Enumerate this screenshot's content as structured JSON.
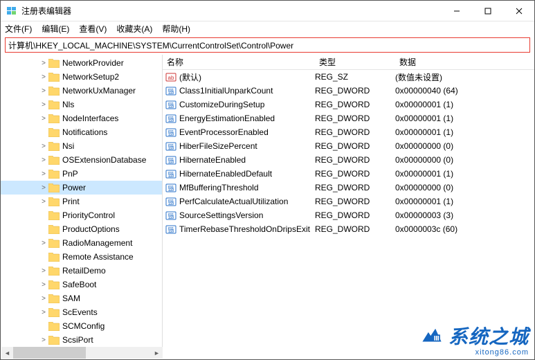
{
  "window": {
    "title": "注册表编辑器"
  },
  "menu": {
    "file": "文件(F)",
    "edit": "编辑(E)",
    "view": "查看(V)",
    "favorites": "收藏夹(A)",
    "help": "帮助(H)"
  },
  "address": "计算机\\HKEY_LOCAL_MACHINE\\SYSTEM\\CurrentControlSet\\Control\\Power",
  "tree": [
    {
      "label": "NetworkProvider",
      "depth": 3,
      "exp": ">"
    },
    {
      "label": "NetworkSetup2",
      "depth": 3,
      "exp": ">"
    },
    {
      "label": "NetworkUxManager",
      "depth": 3,
      "exp": ">"
    },
    {
      "label": "Nls",
      "depth": 3,
      "exp": ">"
    },
    {
      "label": "NodeInterfaces",
      "depth": 3,
      "exp": ">"
    },
    {
      "label": "Notifications",
      "depth": 3,
      "exp": ""
    },
    {
      "label": "Nsi",
      "depth": 3,
      "exp": ">"
    },
    {
      "label": "OSExtensionDatabase",
      "depth": 3,
      "exp": ">"
    },
    {
      "label": "PnP",
      "depth": 3,
      "exp": ">"
    },
    {
      "label": "Power",
      "depth": 3,
      "exp": ">",
      "selected": true
    },
    {
      "label": "Print",
      "depth": 3,
      "exp": ">"
    },
    {
      "label": "PriorityControl",
      "depth": 3,
      "exp": ""
    },
    {
      "label": "ProductOptions",
      "depth": 3,
      "exp": ""
    },
    {
      "label": "RadioManagement",
      "depth": 3,
      "exp": ">"
    },
    {
      "label": "Remote Assistance",
      "depth": 3,
      "exp": ""
    },
    {
      "label": "RetailDemo",
      "depth": 3,
      "exp": ">"
    },
    {
      "label": "SafeBoot",
      "depth": 3,
      "exp": ">"
    },
    {
      "label": "SAM",
      "depth": 3,
      "exp": ">"
    },
    {
      "label": "ScEvents",
      "depth": 3,
      "exp": ">"
    },
    {
      "label": "SCMConfig",
      "depth": 3,
      "exp": ""
    },
    {
      "label": "ScsiPort",
      "depth": 3,
      "exp": ">"
    }
  ],
  "columns": {
    "name": "名称",
    "type": "类型",
    "data": "数据"
  },
  "values": [
    {
      "icon": "sz",
      "name": "(默认)",
      "type": "REG_SZ",
      "data": "(数值未设置)"
    },
    {
      "icon": "dw",
      "name": "Class1InitialUnparkCount",
      "type": "REG_DWORD",
      "data": "0x00000040 (64)"
    },
    {
      "icon": "dw",
      "name": "CustomizeDuringSetup",
      "type": "REG_DWORD",
      "data": "0x00000001 (1)"
    },
    {
      "icon": "dw",
      "name": "EnergyEstimationEnabled",
      "type": "REG_DWORD",
      "data": "0x00000001 (1)"
    },
    {
      "icon": "dw",
      "name": "EventProcessorEnabled",
      "type": "REG_DWORD",
      "data": "0x00000001 (1)"
    },
    {
      "icon": "dw",
      "name": "HiberFileSizePercent",
      "type": "REG_DWORD",
      "data": "0x00000000 (0)"
    },
    {
      "icon": "dw",
      "name": "HibernateEnabled",
      "type": "REG_DWORD",
      "data": "0x00000000 (0)"
    },
    {
      "icon": "dw",
      "name": "HibernateEnabledDefault",
      "type": "REG_DWORD",
      "data": "0x00000001 (1)"
    },
    {
      "icon": "dw",
      "name": "MfBufferingThreshold",
      "type": "REG_DWORD",
      "data": "0x00000000 (0)"
    },
    {
      "icon": "dw",
      "name": "PerfCalculateActualUtilization",
      "type": "REG_DWORD",
      "data": "0x00000001 (1)"
    },
    {
      "icon": "dw",
      "name": "SourceSettingsVersion",
      "type": "REG_DWORD",
      "data": "0x00000003 (3)"
    },
    {
      "icon": "dw",
      "name": "TimerRebaseThresholdOnDripsExit",
      "type": "REG_DWORD",
      "data": "0x0000003c (60)"
    }
  ],
  "watermark": {
    "text": "系统之城",
    "url": "xitong86.com"
  }
}
